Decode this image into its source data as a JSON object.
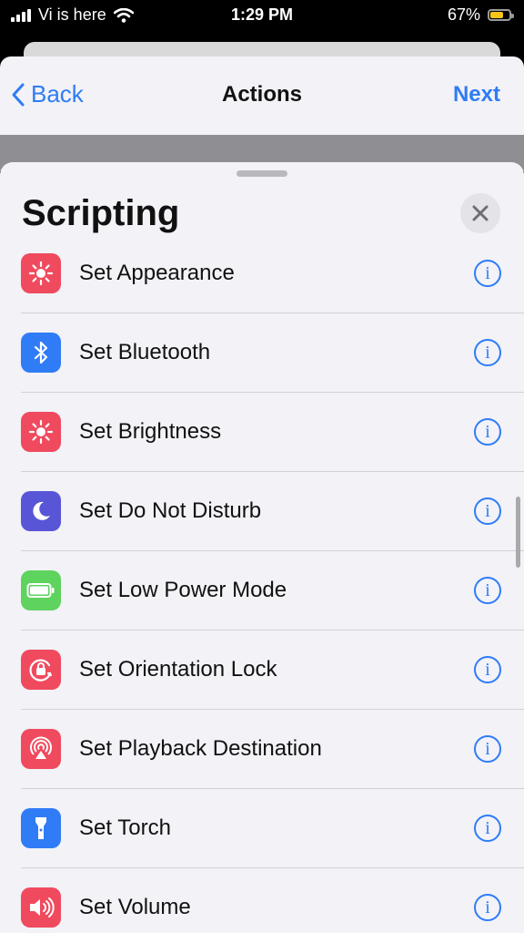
{
  "status": {
    "carrier": "Vi is here",
    "time": "1:29 PM",
    "battery": "67%",
    "battery_level": 0.67
  },
  "nav": {
    "back_label": "Back",
    "title": "Actions",
    "next_label": "Next"
  },
  "sheet": {
    "title": "Scripting"
  },
  "colors": {
    "accent": "#2f7cf6",
    "red": "#f04a5e",
    "blue": "#2f7cf6",
    "purple": "#5856d6",
    "green": "#5ed35e"
  },
  "actions": [
    {
      "label": "Set Appearance",
      "icon": "sun-icon",
      "color": "#f04a5e"
    },
    {
      "label": "Set Bluetooth",
      "icon": "bluetooth-icon",
      "color": "#2f7cf6"
    },
    {
      "label": "Set Brightness",
      "icon": "sun-icon",
      "color": "#f04a5e"
    },
    {
      "label": "Set Do Not Disturb",
      "icon": "moon-icon",
      "color": "#5856d6"
    },
    {
      "label": "Set Low Power Mode",
      "icon": "battery-icon",
      "color": "#5ed35e"
    },
    {
      "label": "Set Orientation Lock",
      "icon": "rotation-lock-icon",
      "color": "#f04a5e"
    },
    {
      "label": "Set Playback Destination",
      "icon": "airplay-icon",
      "color": "#f04a5e"
    },
    {
      "label": "Set Torch",
      "icon": "flashlight-icon",
      "color": "#2f7cf6"
    },
    {
      "label": "Set Volume",
      "icon": "speaker-icon",
      "color": "#f04a5e"
    }
  ]
}
